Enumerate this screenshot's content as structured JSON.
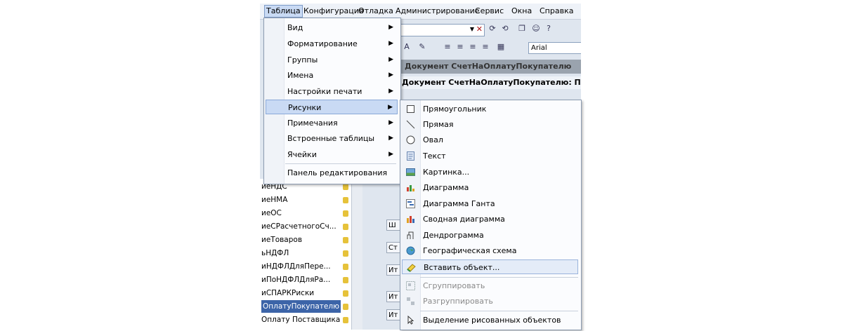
{
  "menubar": {
    "items": [
      "Таблица",
      "Конфигурация",
      "Отладка",
      "Администрирование",
      "Сервис",
      "Окна",
      "Справка"
    ]
  },
  "toolbar": {
    "font_name": "Arial"
  },
  "document": {
    "title": "Документ СчетНаОплатуПокупателю",
    "subtitle": "Документ СчетНаОплатуПокупателю: ПФ_М"
  },
  "tree": {
    "rows": [
      {
        "label": "иеНДС",
        "selected": false
      },
      {
        "label": "иеНМА",
        "selected": false
      },
      {
        "label": "иеОС",
        "selected": false
      },
      {
        "label": "иеСРасчетногоСч...",
        "selected": false
      },
      {
        "label": "иеТоваров",
        "selected": false
      },
      {
        "label": "ьНДФЛ",
        "selected": false
      },
      {
        "label": "иНДФЛДляПере...",
        "selected": false
      },
      {
        "label": "иПоНДФЛДляРа...",
        "selected": false
      },
      {
        "label": "иСПАРКРиски",
        "selected": false
      },
      {
        "label": "ОплатуПокупателю",
        "selected": true
      },
      {
        "label": "Оплату Поставщика",
        "selected": false
      }
    ]
  },
  "middle_tabs": [
    "Ш",
    "Ст",
    "Ит",
    "Ит",
    "Ит"
  ],
  "menu_table": {
    "items": [
      {
        "label": "Вид",
        "submenu": true
      },
      {
        "label": "Форматирование",
        "submenu": true
      },
      {
        "label": "Группы",
        "submenu": true
      },
      {
        "label": "Имена",
        "submenu": true
      },
      {
        "label": "Настройки печати",
        "submenu": true
      },
      {
        "label": "Рисунки",
        "submenu": true,
        "highlighted": true
      },
      {
        "label": "Примечания",
        "submenu": true
      },
      {
        "label": "Встроенные таблицы",
        "submenu": true
      },
      {
        "label": "Ячейки",
        "submenu": true
      },
      {
        "label": "Панель редактирования",
        "submenu": false
      }
    ]
  },
  "menu_pictures": {
    "items": [
      {
        "label": "Прямоугольник",
        "icon": "rectangle-icon"
      },
      {
        "label": "Прямая",
        "icon": "line-icon"
      },
      {
        "label": "Овал",
        "icon": "oval-icon"
      },
      {
        "label": "Текст",
        "icon": "text-icon"
      },
      {
        "label": "Картинка...",
        "icon": "picture-icon"
      },
      {
        "label": "Диаграмма",
        "icon": "chart-icon"
      },
      {
        "label": "Диаграмма Ганта",
        "icon": "gantt-chart-icon"
      },
      {
        "label": "Сводная диаграмма",
        "icon": "pivot-chart-icon"
      },
      {
        "label": "Дендрограмма",
        "icon": "dendrogram-icon"
      },
      {
        "label": "Географическая схема",
        "icon": "geo-schema-icon"
      },
      {
        "label": "Вставить объект...",
        "icon": "insert-object-icon",
        "highlighted": true
      },
      {
        "label": "Сгруппировать",
        "icon": "group-icon",
        "disabled": true
      },
      {
        "label": "Разгруппировать",
        "icon": "ungroup-icon",
        "disabled": true
      },
      {
        "label": "Выделение рисованных объектов",
        "icon": "select-drawn-objects-icon"
      }
    ]
  }
}
